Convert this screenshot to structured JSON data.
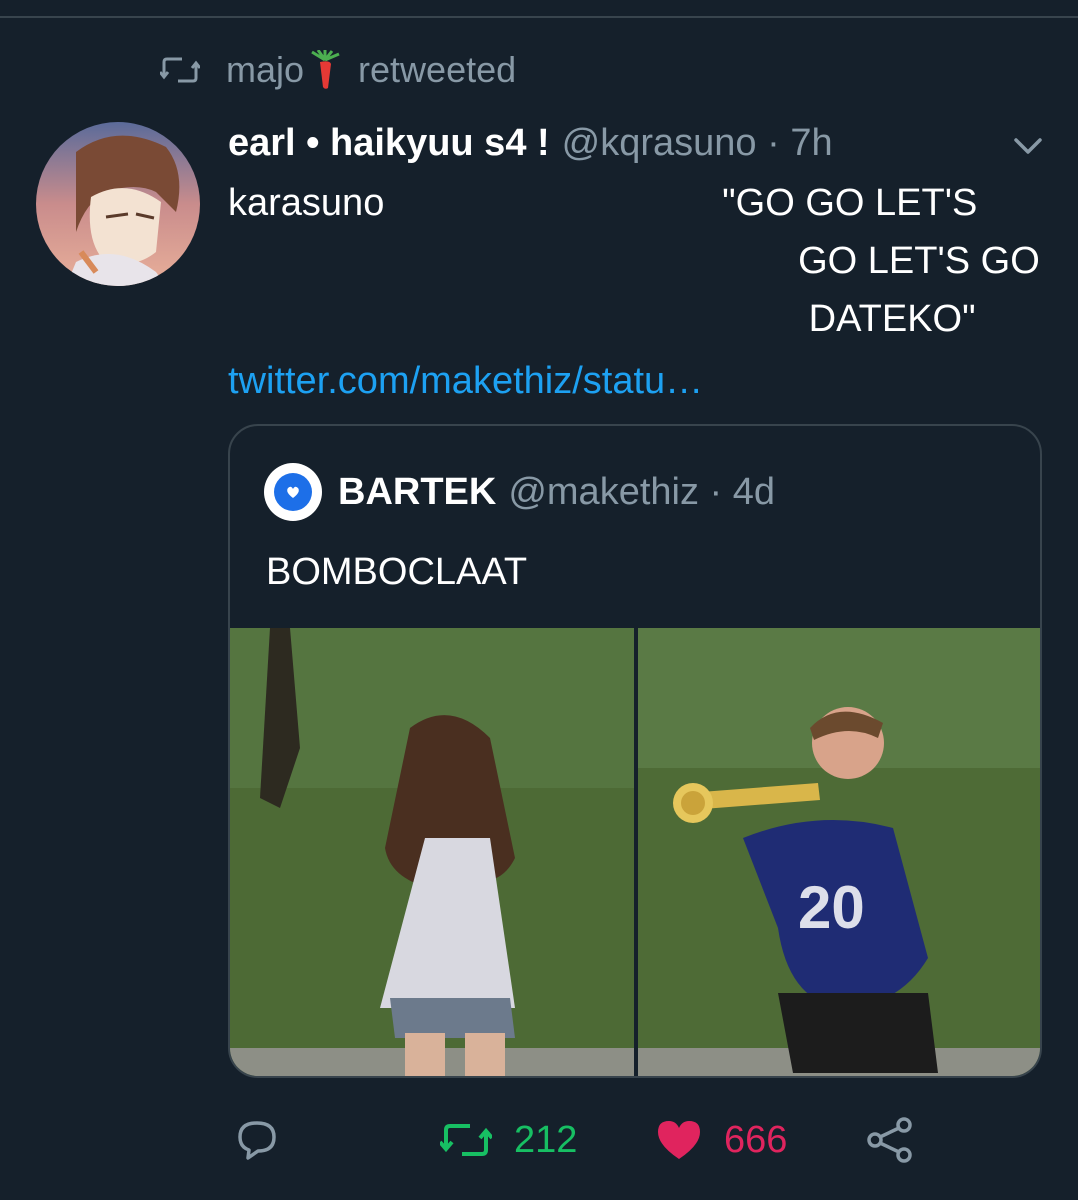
{
  "retweet_banner": {
    "user": "majo",
    "action": "retweeted"
  },
  "tweet": {
    "display_name": "earl • haikyuu s4 !",
    "handle_time": "@kqrasuno · 7h",
    "text": "karasuno                                \"GO GO LET'S\n                                                      GO LET'S GO\n                                                       DATEKO\"",
    "link": "twitter.com/makethiz/statu…"
  },
  "quote": {
    "display_name": "BARTEK",
    "handle_time": "@makethiz · 4d",
    "text": "BOMBOCLAAT"
  },
  "actions": {
    "retweet_count": "212",
    "like_count": "666"
  },
  "colors": {
    "background": "#15202b",
    "accent_blue": "#1da1f2",
    "retweet_green": "#17bf63",
    "like_pink": "#e0245e",
    "muted": "#8899a6"
  }
}
